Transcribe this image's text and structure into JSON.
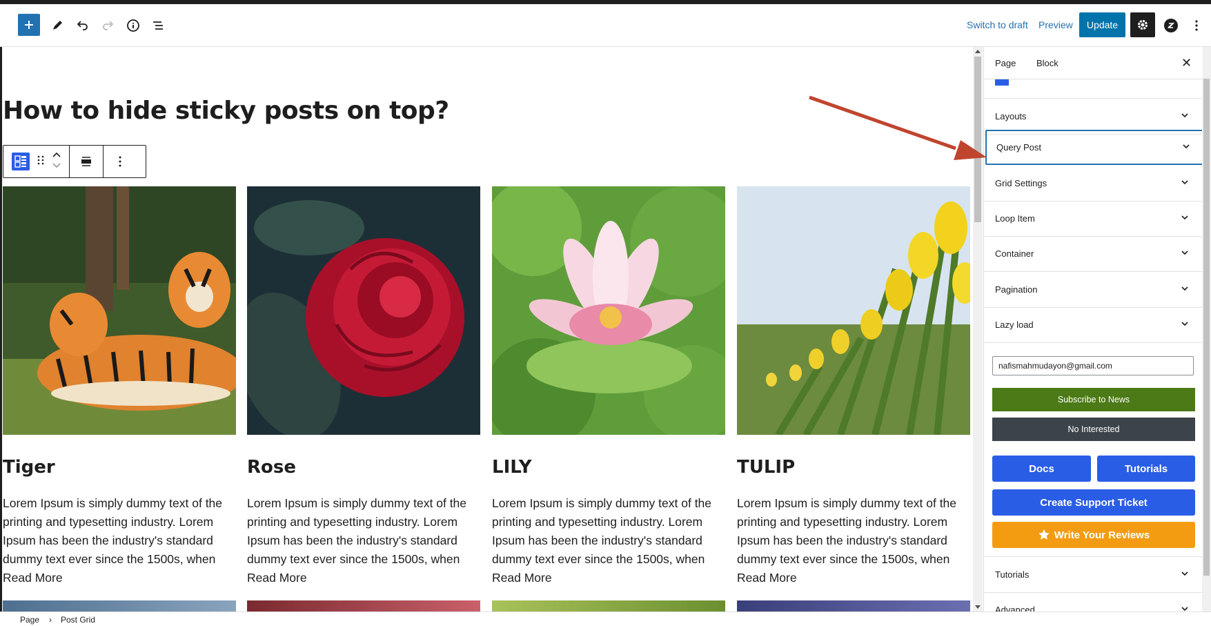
{
  "toolbar": {
    "add_label": "+",
    "switch_to_draft": "Switch to draft",
    "preview": "Preview",
    "update": "Update"
  },
  "editor": {
    "page_title": "How to hide sticky posts on top?",
    "posts": [
      {
        "title": "Tiger",
        "excerpt": "Lorem Ipsum is simply dummy text of the printing and typesetting industry. Lorem Ipsum has been the industry's standard dummy text ever since the 1500s, when",
        "read_more": "Read More"
      },
      {
        "title": "Rose",
        "excerpt": "Lorem Ipsum is simply dummy text of the printing and typesetting industry. Lorem Ipsum has been the industry's standard dummy text ever since the 1500s, when",
        "read_more": "Read More"
      },
      {
        "title": "LILY",
        "excerpt": "Lorem Ipsum is simply dummy text of the printing and typesetting industry. Lorem Ipsum has been the industry's standard dummy text ever since the 1500s, when",
        "read_more": "Read More"
      },
      {
        "title": "TULIP",
        "excerpt": "Lorem Ipsum is simply dummy text of the printing and typesetting industry. Lorem Ipsum has been the industry's standard dummy text ever since the 1500s, when",
        "read_more": "Read More"
      }
    ]
  },
  "sidebar": {
    "tabs": [
      {
        "label": "Page"
      },
      {
        "label": "Block"
      }
    ],
    "close": "✕",
    "panels": [
      {
        "label": "Layouts"
      },
      {
        "label": "Query Post"
      },
      {
        "label": "Grid Settings"
      },
      {
        "label": "Loop Item"
      },
      {
        "label": "Container"
      },
      {
        "label": "Pagination"
      },
      {
        "label": "Lazy load"
      }
    ],
    "email_value": "nafismahmudayon@gmail.com",
    "subscribe": "Subscribe to News",
    "no_interest": "No Interested",
    "docs": "Docs",
    "tutorials_btn": "Tutorials",
    "support": "Create Support Ticket",
    "reviews": "Write Your Reviews",
    "bottom_panels": [
      {
        "label": "Tutorials"
      },
      {
        "label": "Advanced"
      }
    ]
  },
  "breadcrumb": {
    "items": [
      "Page",
      "Post Grid"
    ],
    "separator": "›"
  },
  "colors": {
    "accent": "#2271b1",
    "update_bg": "#0073aa",
    "subscribe_bg": "#4b7a17",
    "no_interest_bg": "#3c434a",
    "support_blue": "#2a5de6",
    "review_orange": "#f39c12",
    "annotation_arrow": "#c0452f"
  }
}
